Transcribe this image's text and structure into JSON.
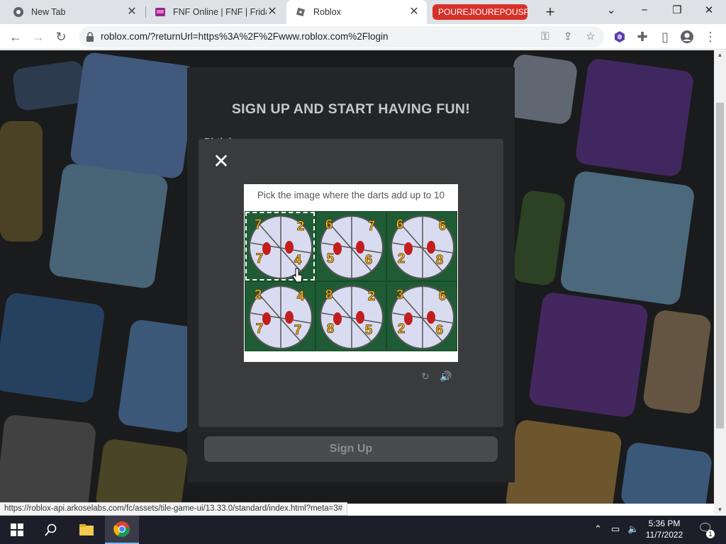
{
  "browser": {
    "tabs": [
      {
        "title": "New Tab",
        "icon": "chrome-icon"
      },
      {
        "title": "FNF Online | FNF | Friday",
        "icon": "fnf-icon"
      },
      {
        "title": "Roblox",
        "icon": "roblox-icon",
        "active": true
      },
      {
        "title": "POUREJIOUREPOUSPO",
        "icon": "",
        "accent": "#d8312a"
      }
    ],
    "url": "roblox.com/?returnUrl=https%3A%2F%2Fwww.roblox.com%2Flogin",
    "status_url": "https://roblox-api.arkoselabs.com/fc/assets/tile-game-ui/13.33.0/standard/index.html?meta=3#"
  },
  "signup": {
    "title": "SIGN UP AND START HAVING FUN!",
    "birthday_label": "Birthday",
    "button_label": "Sign Up"
  },
  "captcha": {
    "prompt": "Pick the image where the darts add up to 10",
    "tiles": [
      {
        "numbers": [
          "7",
          "2",
          "7",
          "4"
        ],
        "selected": true
      },
      {
        "numbers": [
          "6",
          "7",
          "5",
          "6"
        ],
        "selected": false
      },
      {
        "numbers": [
          "6",
          "6",
          "2",
          "8"
        ],
        "selected": false
      },
      {
        "numbers": [
          "2",
          "4",
          "7",
          "7"
        ],
        "selected": false
      },
      {
        "numbers": [
          "8",
          "2",
          "8",
          "5"
        ],
        "selected": false
      },
      {
        "numbers": [
          "3",
          "6",
          "2",
          "6"
        ],
        "selected": false
      }
    ]
  },
  "taskbar": {
    "time": "5:36 PM",
    "date": "11/7/2022",
    "notification_count": "1"
  },
  "colors": {
    "tabbar": "#dee1e6",
    "page_bg": "#2b2c2f",
    "modal_bg": "#393b3d",
    "tile_green": "#1f5c36",
    "dart_red": "#c21e1e",
    "number_gold": "#f0b429"
  }
}
